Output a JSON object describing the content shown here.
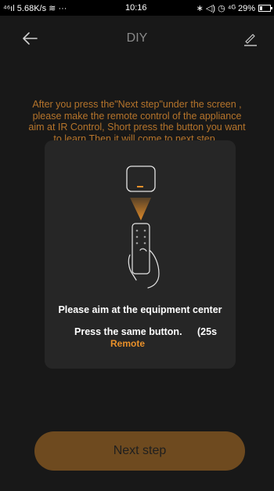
{
  "status_bar": {
    "network": "⁴⁶ıl 5.68K/s ≋ ···",
    "time": "10:16",
    "indicators": "∗ ◁) ◷ ⁴ᴳ 29%",
    "battery_level": 0.29
  },
  "header": {
    "title": "DIY",
    "back_icon": "arrow-left-icon",
    "edit_icon": "pencil-icon"
  },
  "instructions": {
    "line1": "After you press the\"Next step\"under the screen ,",
    "line2": "please make the remote control of the appliance",
    "line3": "aim at IR Control, Short press the button you want",
    "line4": "to learn,Then it  will come to next step ."
  },
  "card": {
    "heading": "Please aim at the equipment center",
    "press_text": "Press the same button.",
    "countdown": "(25s",
    "remote_label": "Remote"
  },
  "footer": {
    "next_label": "Next step"
  },
  "colors": {
    "background": "#181818",
    "accent_text": "#b5742b",
    "button_fill": "#6e4a1f",
    "card_fill": "#262626",
    "remote_highlight": "#e8902a"
  }
}
